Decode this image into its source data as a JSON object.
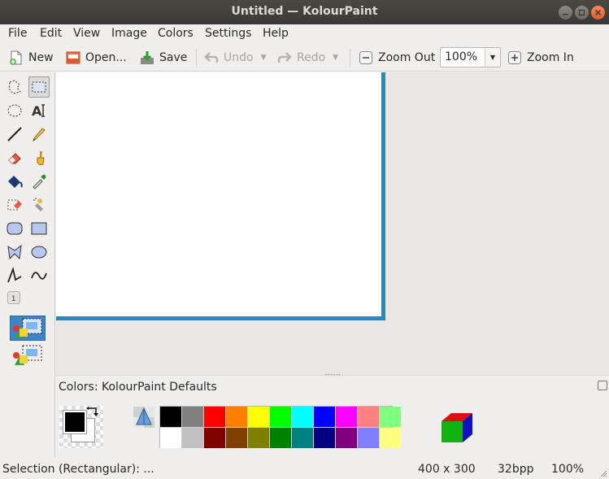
{
  "window": {
    "title": "Untitled  — KolourPaint"
  },
  "menu": [
    {
      "label": "File"
    },
    {
      "label": "Edit"
    },
    {
      "label": "View"
    },
    {
      "label": "Image"
    },
    {
      "label": "Colors"
    },
    {
      "label": "Settings"
    },
    {
      "label": "Help"
    }
  ],
  "toolbar": {
    "new_label": "New",
    "open_label": "Open...",
    "save_label": "Save",
    "undo_label": "Undo",
    "redo_label": "Redo",
    "zoom_out_label": "Zoom Out",
    "zoom_value": "100%",
    "zoom_in_label": "Zoom In"
  },
  "tools": [
    "free-form-selection",
    "rectangular-selection",
    "elliptical-selection",
    "text",
    "line",
    "pen",
    "eraser",
    "brush",
    "flood-fill",
    "color-picker",
    "color-eraser",
    "spraycan",
    "rounded-rectangle",
    "rectangle",
    "polygon",
    "ellipse",
    "connected-lines",
    "curve"
  ],
  "colors": {
    "dock_label": "Colors: KolourPaint Defaults",
    "foreground": "#000000",
    "background": "#ffffff",
    "palette": [
      "#000000",
      "#808080",
      "#ff0000",
      "#ff8000",
      "#ffff00",
      "#00ff00",
      "#00ffff",
      "#0000ff",
      "#ff00ff",
      "#ff8080",
      "#80ff80",
      "#ffffff",
      "#c0c0c0",
      "#800000",
      "#804000",
      "#808000",
      "#008000",
      "#008080",
      "#000080",
      "#800080",
      "#8080ff",
      "#ffff80"
    ]
  },
  "status": {
    "tool": "Selection (Rectangular): ...",
    "dimensions": "400 x 300",
    "depth": "32bpp",
    "zoom": "100%"
  }
}
